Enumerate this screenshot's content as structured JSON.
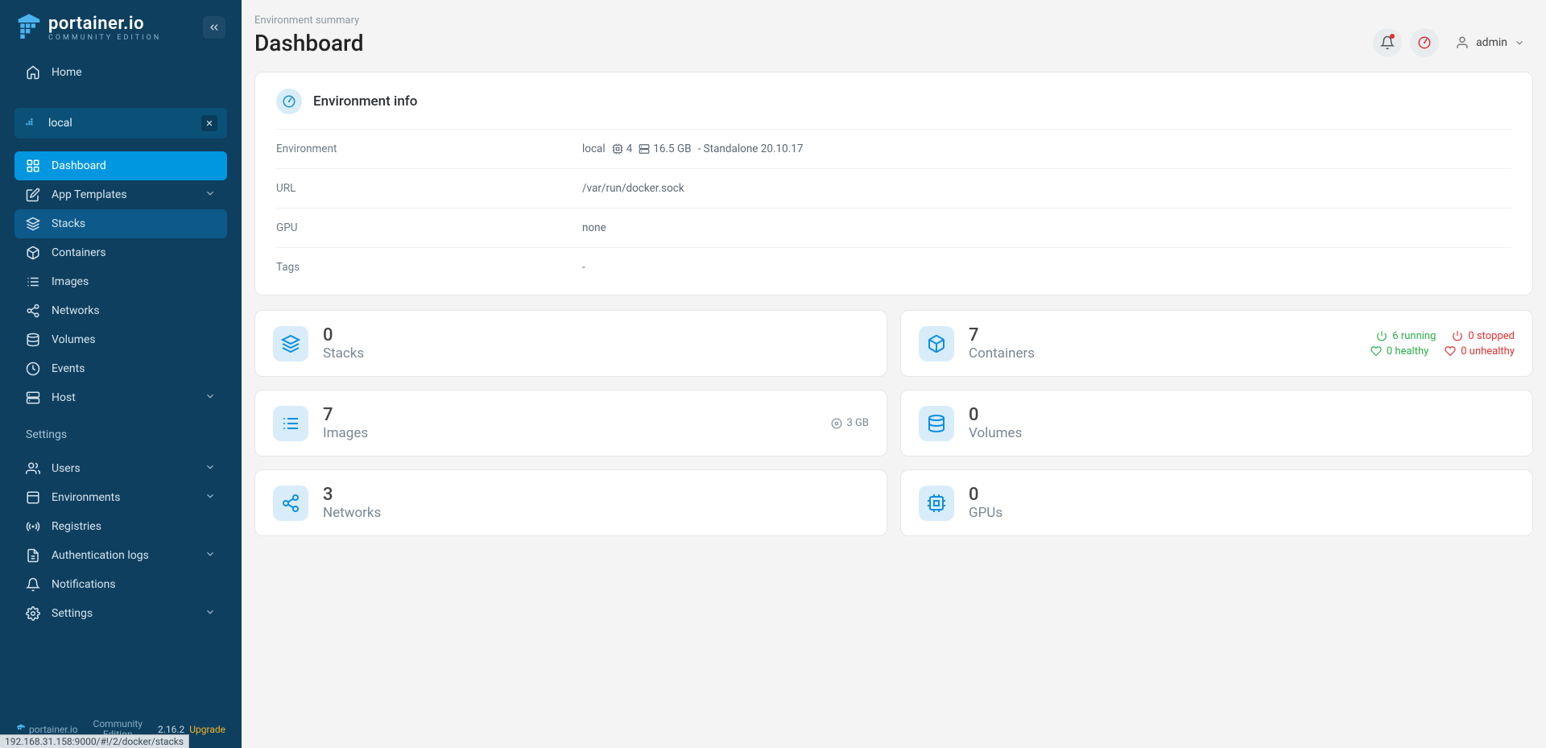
{
  "brand": {
    "name": "portainer.io",
    "edition": "COMMUNITY EDITION"
  },
  "nav": {
    "home": "Home",
    "env_label": "local",
    "items": [
      {
        "label": "Dashboard",
        "icon": "grid",
        "active": true
      },
      {
        "label": "App Templates",
        "icon": "edit",
        "chev": true
      },
      {
        "label": "Stacks",
        "icon": "layers",
        "hover": true
      },
      {
        "label": "Containers",
        "icon": "box"
      },
      {
        "label": "Images",
        "icon": "list"
      },
      {
        "label": "Networks",
        "icon": "share"
      },
      {
        "label": "Volumes",
        "icon": "db"
      },
      {
        "label": "Events",
        "icon": "clock"
      },
      {
        "label": "Host",
        "icon": "server",
        "chev": true
      }
    ],
    "settings_label": "Settings",
    "settings": [
      {
        "label": "Users",
        "icon": "users",
        "chev": true
      },
      {
        "label": "Environments",
        "icon": "env",
        "chev": true
      },
      {
        "label": "Registries",
        "icon": "radio"
      },
      {
        "label": "Authentication logs",
        "icon": "file",
        "chev": true
      },
      {
        "label": "Notifications",
        "icon": "bell"
      },
      {
        "label": "Settings",
        "icon": "gear",
        "chev": true
      }
    ]
  },
  "footer": {
    "brand": "portainer.io",
    "edition": "Community Edition",
    "version": "2.16.2",
    "upgrade": "Upgrade",
    "status_url": "192.168.31.158:9000/#!/2/docker/stacks"
  },
  "breadcrumb": "Environment summary",
  "title": "Dashboard",
  "user": "admin",
  "env_info": {
    "heading": "Environment info",
    "rows": {
      "env": {
        "label": "Environment",
        "name": "local",
        "cpu": "4",
        "ram": "16.5 GB",
        "type": "Standalone 20.10.17"
      },
      "url": {
        "label": "URL",
        "value": "/var/run/docker.sock"
      },
      "gpu": {
        "label": "GPU",
        "value": "none"
      },
      "tags": {
        "label": "Tags",
        "value": "-"
      }
    }
  },
  "stats": {
    "stacks": {
      "n": "0",
      "l": "Stacks"
    },
    "containers": {
      "n": "7",
      "l": "Containers",
      "running": "6 running",
      "stopped": "0 stopped",
      "healthy": "0 healthy",
      "unhealthy": "0 unhealthy"
    },
    "images": {
      "n": "7",
      "l": "Images",
      "size": "3 GB"
    },
    "volumes": {
      "n": "0",
      "l": "Volumes"
    },
    "networks": {
      "n": "3",
      "l": "Networks"
    },
    "gpus": {
      "n": "0",
      "l": "GPUs"
    }
  }
}
